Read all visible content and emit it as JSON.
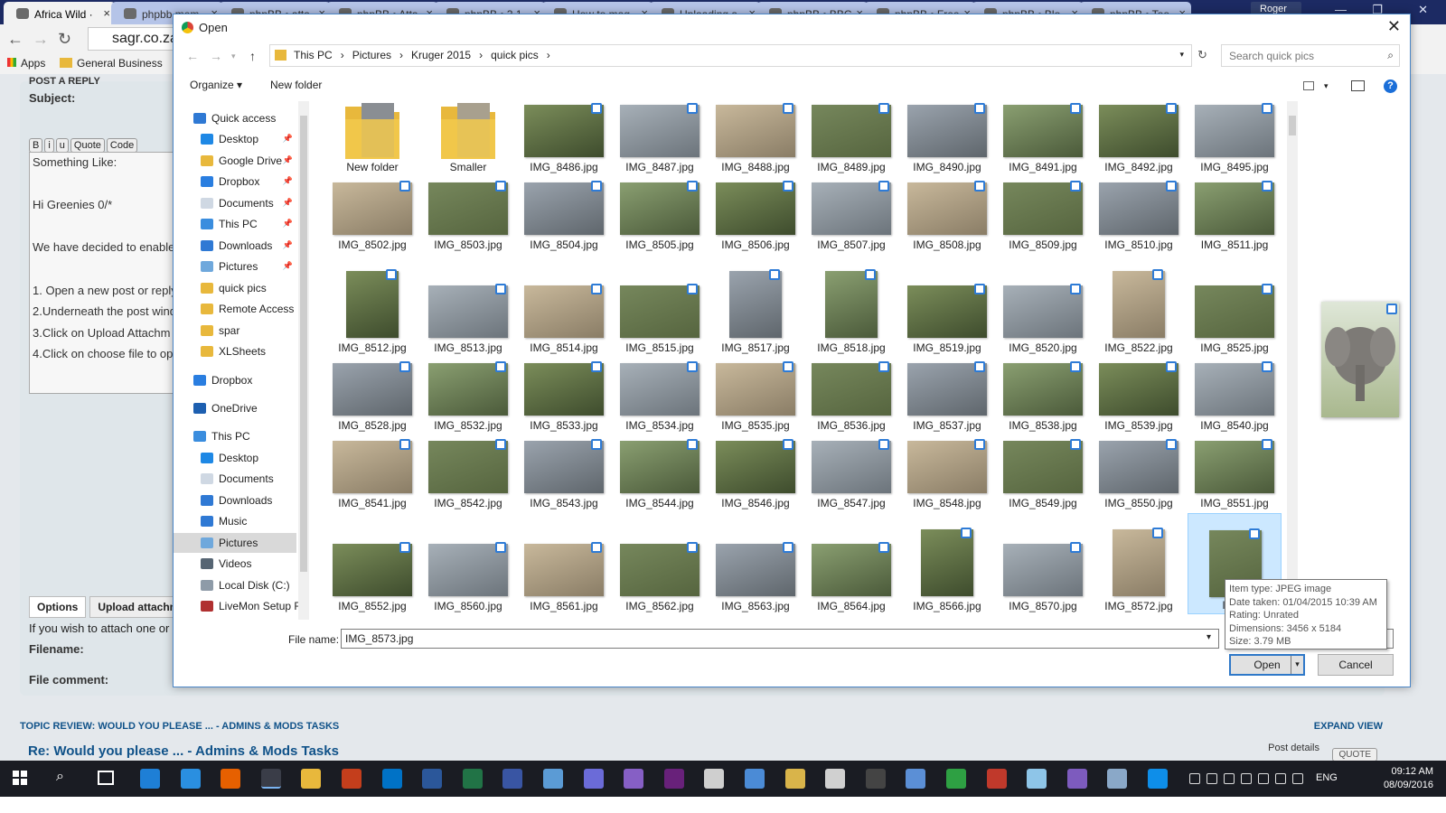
{
  "browser": {
    "tabs": [
      "Africa Wild ·",
      "phpbb.mem",
      "phpBB • atta",
      "phpBB • Atta",
      "phpBB • 3.1",
      "How to mag",
      "Uploading a",
      "phpBB • BBC",
      "phpBB • Free",
      "phpBB • Blo",
      "phpBB • Too"
    ],
    "tab_close": "×",
    "profile": "Roger",
    "url": "sagr.co.za/",
    "bookmarks": {
      "apps": "Apps",
      "general": "General Business"
    }
  },
  "page": {
    "post_reply": "POST A REPLY",
    "subject_label": "Subject:",
    "format_buttons": [
      "B",
      "i",
      "u",
      "Quote",
      "Code"
    ],
    "message_lines": [
      "Something Like:",
      "",
      "Hi Greenies  0/*",
      "",
      "We have decided to enable",
      "",
      "1. Open a new post or reply",
      "2.Underneath the post wind",
      "3.Click on Upload Attachm",
      "4.Click on choose file to op"
    ],
    "tabs": [
      "Options",
      "Upload attachm"
    ],
    "attach_note": "If you wish to attach one or",
    "filename_label": "Filename:",
    "file_comment_label": "File comment:",
    "review_header": "TOPIC REVIEW: WOULD YOU PLEASE ... - ADMINS & MODS TASKS",
    "expand_view": "EXPAND VIEW",
    "review_title": "Re: Would you please ... - Admins & Mods Tasks",
    "post_details": "Post details",
    "quote": "QUOTE"
  },
  "dialog": {
    "title": "Open",
    "breadcrumb": [
      "This PC",
      "Pictures",
      "Kruger 2015",
      "quick pics"
    ],
    "search_placeholder": "Search quick pics",
    "organize": "Organize ▾",
    "new_folder": "New folder",
    "nav": [
      {
        "label": "Quick access",
        "icon": "star"
      },
      {
        "label": "Desktop",
        "icon": "desktop",
        "pinned": true
      },
      {
        "label": "Google Drive",
        "icon": "folder",
        "pinned": true
      },
      {
        "label": "Dropbox",
        "icon": "dropbox",
        "pinned": true
      },
      {
        "label": "Documents",
        "icon": "documents",
        "pinned": true
      },
      {
        "label": "This PC",
        "icon": "pc",
        "pinned": true
      },
      {
        "label": "Downloads",
        "icon": "downloads",
        "pinned": true
      },
      {
        "label": "Pictures",
        "icon": "pictures",
        "pinned": true
      },
      {
        "label": "quick pics",
        "icon": "folder"
      },
      {
        "label": "Remote Access",
        "icon": "folder"
      },
      {
        "label": "spar",
        "icon": "folder"
      },
      {
        "label": "XLSheets",
        "icon": "folder"
      },
      {
        "label": "Dropbox",
        "icon": "dropbox"
      },
      {
        "label": "OneDrive",
        "icon": "onedrive"
      },
      {
        "label": "This PC",
        "icon": "pc"
      },
      {
        "label": "Desktop",
        "icon": "desktop"
      },
      {
        "label": "Documents",
        "icon": "documents"
      },
      {
        "label": "Downloads",
        "icon": "downloads"
      },
      {
        "label": "Music",
        "icon": "music"
      },
      {
        "label": "Pictures",
        "icon": "pictures",
        "selected": true
      },
      {
        "label": "Videos",
        "icon": "videos"
      },
      {
        "label": "Local Disk (C:)",
        "icon": "disk"
      },
      {
        "label": "LiveMon Setup F",
        "icon": "setup"
      }
    ],
    "files": [
      "New folder",
      "Smaller",
      "IMG_8486.jpg",
      "IMG_8487.jpg",
      "IMG_8488.jpg",
      "IMG_8489.jpg",
      "IMG_8490.jpg",
      "IMG_8491.jpg",
      "IMG_8492.jpg",
      "IMG_8495.jpg",
      "IMG_8502.jpg",
      "IMG_8503.jpg",
      "IMG_8504.jpg",
      "IMG_8505.jpg",
      "IMG_8506.jpg",
      "IMG_8507.jpg",
      "IMG_8508.jpg",
      "IMG_8509.jpg",
      "IMG_8510.jpg",
      "IMG_8511.jpg",
      "IMG_8512.jpg",
      "IMG_8513.jpg",
      "IMG_8514.jpg",
      "IMG_8515.jpg",
      "IMG_8517.jpg",
      "IMG_8518.jpg",
      "IMG_8519.jpg",
      "IMG_8520.jpg",
      "IMG_8522.jpg",
      "IMG_8525.jpg",
      "IMG_8528.jpg",
      "IMG_8532.jpg",
      "IMG_8533.jpg",
      "IMG_8534.jpg",
      "IMG_8535.jpg",
      "IMG_8536.jpg",
      "IMG_8537.jpg",
      "IMG_8538.jpg",
      "IMG_8539.jpg",
      "IMG_8540.jpg",
      "IMG_8541.jpg",
      "IMG_8542.jpg",
      "IMG_8543.jpg",
      "IMG_8544.jpg",
      "IMG_8546.jpg",
      "IMG_8547.jpg",
      "IMG_8548.jpg",
      "IMG_8549.jpg",
      "IMG_8550.jpg",
      "IMG_8551.jpg",
      "IMG_8552.jpg",
      "IMG_8560.jpg",
      "IMG_8561.jpg",
      "IMG_8562.jpg",
      "IMG_8563.jpg",
      "IMG_8564.jpg",
      "IMG_8566.jpg",
      "IMG_8570.jpg",
      "IMG_8572.jpg",
      "IMG_"
    ],
    "filename_label": "File name:",
    "filename_value": "IMG_8573.jpg",
    "open_button": "Open",
    "cancel_button": "Cancel",
    "tooltip": [
      "Item type: JPEG image",
      "Date taken: 01/04/2015 10:39 AM",
      "Rating: Unrated",
      "Dimensions: 3456 x 5184",
      "Size: 3.79 MB"
    ]
  },
  "taskbar": {
    "lang": "ENG",
    "time": "09:12 AM",
    "date": "08/09/2016"
  }
}
